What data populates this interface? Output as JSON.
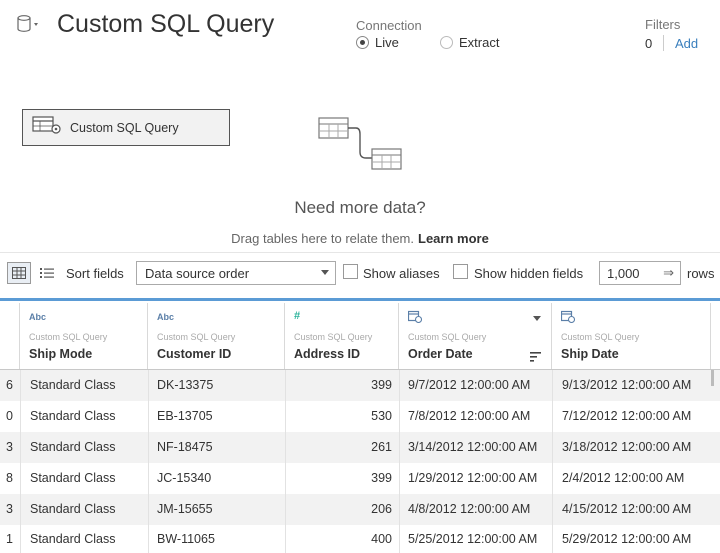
{
  "header": {
    "title": "Custom SQL Query",
    "connection_label": "Connection",
    "live_label": "Live",
    "extract_label": "Extract",
    "filters_label": "Filters",
    "filters_count": "0",
    "filters_add": "Add"
  },
  "canvas": {
    "node_label": "Custom SQL Query",
    "need_more": "Need more data?",
    "drag_text": "Drag tables here to relate them.",
    "learn_more": "Learn more"
  },
  "toolbar": {
    "sort_label": "Sort fields",
    "sort_value": "Data source order",
    "show_aliases": "Show aliases",
    "show_hidden": "Show hidden fields",
    "rows_value": "1,000",
    "rows_label": "rows"
  },
  "columns": [
    {
      "type": "Abc",
      "source": "Custom SQL Query",
      "name": "Ship Mode"
    },
    {
      "type": "Abc",
      "source": "Custom SQL Query",
      "name": "Customer ID"
    },
    {
      "type": "#",
      "source": "Custom SQL Query",
      "name": "Address ID"
    },
    {
      "type": "calendar-icon",
      "source": "Custom SQL Query",
      "name": "Order Date"
    },
    {
      "type": "calendar-icon",
      "source": "Custom SQL Query",
      "name": "Ship Date"
    }
  ],
  "rows": [
    {
      "lead": "6",
      "ship_mode": "Standard Class",
      "customer_id": "DK-13375",
      "address_id": "399",
      "order_date": "9/7/2012 12:00:00 AM",
      "ship_date": "9/13/2012 12:00:00 AM"
    },
    {
      "lead": "0",
      "ship_mode": "Standard Class",
      "customer_id": "EB-13705",
      "address_id": "530",
      "order_date": "7/8/2012 12:00:00 AM",
      "ship_date": "7/12/2012 12:00:00 AM"
    },
    {
      "lead": "3",
      "ship_mode": "Standard Class",
      "customer_id": "NF-18475",
      "address_id": "261",
      "order_date": "3/14/2012 12:00:00 AM",
      "ship_date": "3/18/2012 12:00:00 AM"
    },
    {
      "lead": "8",
      "ship_mode": "Standard Class",
      "customer_id": "JC-15340",
      "address_id": "399",
      "order_date": "1/29/2012 12:00:00 AM",
      "ship_date": "2/4/2012 12:00:00 AM"
    },
    {
      "lead": "3",
      "ship_mode": "Standard Class",
      "customer_id": "JM-15655",
      "address_id": "206",
      "order_date": "4/8/2012 12:00:00 AM",
      "ship_date": "4/15/2012 12:00:00 AM"
    },
    {
      "lead": "1",
      "ship_mode": "Standard Class",
      "customer_id": "BW-11065",
      "address_id": "400",
      "order_date": "5/25/2012 12:00:00 AM",
      "ship_date": "5/29/2012 12:00:00 AM"
    }
  ],
  "colors": {
    "accent": "#5b9bd5",
    "link": "#3a7fbd",
    "number_icon": "#2bb39b"
  }
}
